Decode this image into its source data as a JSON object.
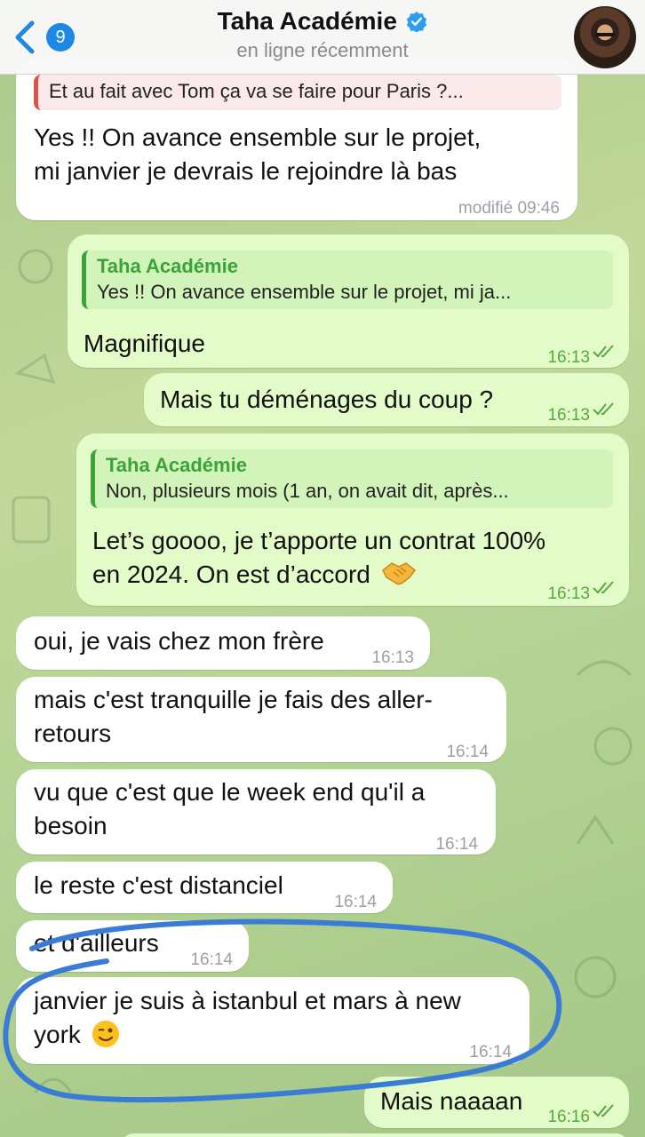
{
  "header": {
    "back_count": "9",
    "title": "Taha Académie",
    "status": "en ligne récemment"
  },
  "messages": [
    {
      "direction": "in",
      "reply_text": "Et au fait avec Tom ça va se faire pour Paris ?...",
      "lines": [
        "Yes !! On avance ensemble sur le projet,",
        "mi janvier je devrais le rejoindre là bas"
      ],
      "time": "modifié 09:46"
    },
    {
      "direction": "out",
      "reply_author": "Taha Académie",
      "reply_text": "Yes !! On avance ensemble sur le projet, mi ja...",
      "lines": [
        "Magnifique"
      ],
      "time": "16:13"
    },
    {
      "direction": "out",
      "lines": [
        "Mais tu déménages du coup ?"
      ],
      "time": "16:13"
    },
    {
      "direction": "out",
      "reply_author": "Taha Académie",
      "reply_text": "Non, plusieurs mois (1 an, on avait dit, après...",
      "lines": [
        "Let’s goooo, je t’apporte un contrat 100%",
        "en 2024. On est d’accord"
      ],
      "time": "16:13"
    },
    {
      "direction": "in",
      "lines": [
        "oui, je vais chez mon frère"
      ],
      "time": "16:13"
    },
    {
      "direction": "in",
      "lines": [
        "mais c'est tranquille je fais des aller-",
        "retours"
      ],
      "time": "16:14"
    },
    {
      "direction": "in",
      "lines": [
        "vu que c'est que le week end qu'il a",
        "besoin"
      ],
      "time": "16:14"
    },
    {
      "direction": "in",
      "lines": [
        "le reste c'est distanciel"
      ],
      "time": "16:14"
    },
    {
      "direction": "in",
      "lines": [
        "et d'ailleurs"
      ],
      "time": "16:14"
    },
    {
      "direction": "in",
      "lines": [
        "janvier je suis à istanbul et mars à new",
        "york"
      ],
      "time": "16:14"
    },
    {
      "direction": "out",
      "lines": [
        "Mais naaaan"
      ],
      "time": "16:16"
    }
  ],
  "icons": {
    "back": "chevron-left-icon",
    "verified": "verified-badge-icon",
    "read": "double-check-icon",
    "handshake": "handshake-emoji",
    "wink": "winking-face-emoji"
  },
  "colors": {
    "accent": "#1e88e5",
    "outgoing_bubble": "#e3fbc8",
    "incoming_bubble": "#ffffff",
    "read_check": "#56a93c",
    "annotation_stroke": "#3a7bd5"
  }
}
